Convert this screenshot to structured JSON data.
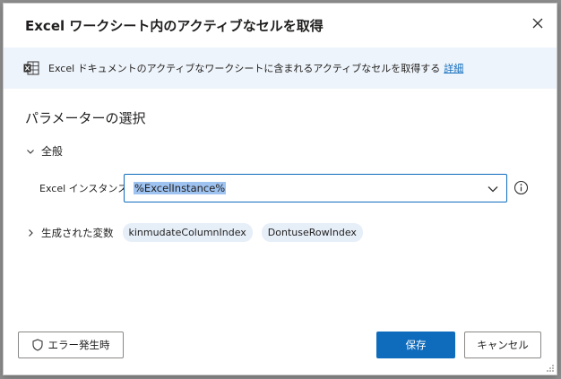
{
  "dialog": {
    "title": "Excel ワークシート内のアクティブなセルを取得",
    "close_icon": "close-icon"
  },
  "info_bar": {
    "icon": "excel-icon",
    "text": "Excel ドキュメントのアクティブなワークシートに含まれるアクティブなセルを取得する",
    "link": "詳細"
  },
  "parameters": {
    "section_title": "パラメーターの選択",
    "general_group": {
      "label": "全般",
      "expanded": true
    },
    "excel_instance": {
      "label": "Excel インスタンス:",
      "value": "%ExcelInstance%"
    }
  },
  "generated_variables": {
    "label": "生成された変数",
    "expanded": false,
    "chips": [
      "kinmudateColumnIndex",
      "DontuseRowIndex"
    ]
  },
  "footer": {
    "error_button": "エラー発生時",
    "save_button": "保存",
    "cancel_button": "キャンセル"
  },
  "colors": {
    "accent": "#0f6cbd",
    "info_bar_bg": "#eef4fb",
    "chip_bg": "#e6eef8",
    "selection": "#9fc3f1"
  }
}
